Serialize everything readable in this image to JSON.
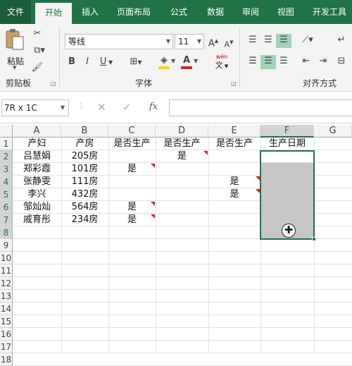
{
  "tabs": [
    "文件",
    "开始",
    "插入",
    "页面布局",
    "公式",
    "数据",
    "审阅",
    "视图",
    "开发工具"
  ],
  "ribbon": {
    "paste": "粘贴",
    "font_name": "等线",
    "font_size": "11",
    "grow_font": "A",
    "shrink_font": "A",
    "bold": "B",
    "italic": "I",
    "underline": "U",
    "phonetic_top": "wén",
    "phonetic_bottom": "文",
    "groups": {
      "clipboard": "剪贴板",
      "font": "字体",
      "alignment": "对齐方式"
    }
  },
  "formula_bar": {
    "name_box": "7R x 1C",
    "fx": "fx",
    "value": ""
  },
  "columns": [
    "A",
    "B",
    "C",
    "D",
    "E",
    "F",
    "G"
  ],
  "rows": [
    "1",
    "2",
    "3",
    "4",
    "5",
    "6",
    "7",
    "8",
    "9",
    "10",
    "11",
    "12",
    "13",
    "14",
    "15",
    "16",
    "17",
    "18"
  ],
  "cells": {
    "r1": [
      "产妇",
      "产房",
      "是否生产",
      "是否生产",
      "是否生产",
      "生产日期"
    ],
    "r2": [
      "吕慧娟",
      "205房",
      "",
      "是",
      "",
      ""
    ],
    "r3": [
      "郑彩霞",
      "101房",
      "是",
      "",
      "",
      ""
    ],
    "r4": [
      "张静雯",
      "111房",
      "",
      "",
      "是",
      ""
    ],
    "r5": [
      "李兴",
      "432房",
      "",
      "",
      "是",
      ""
    ],
    "r6": [
      "邹灿灿",
      "564房",
      "是",
      "",
      "",
      ""
    ],
    "r7": [
      "戚育彤",
      "234房",
      "是",
      "",
      "",
      ""
    ]
  },
  "selection": {
    "column": "F",
    "rows": [
      2,
      8
    ]
  },
  "colors": {
    "brand": "#217346",
    "selection_fill": "#c6c6c6",
    "comment_marker": "#e02020",
    "highlight_fill": "#ffd400",
    "font_color": "#e02020"
  }
}
